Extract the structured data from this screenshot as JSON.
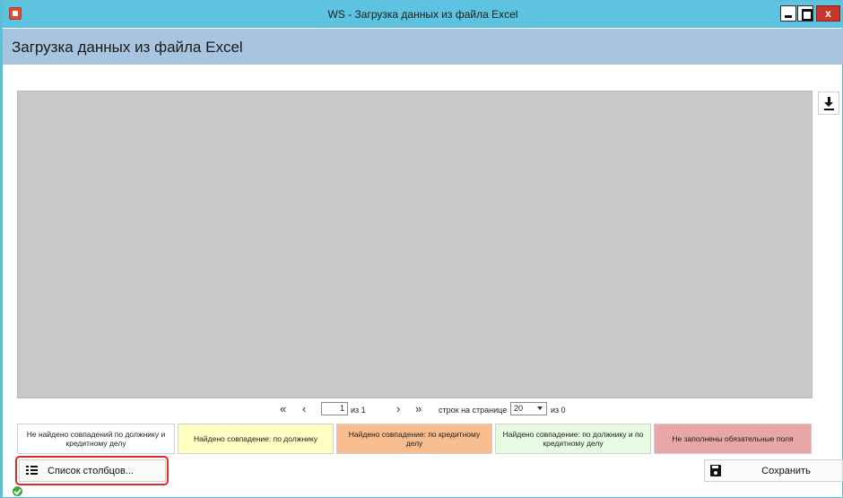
{
  "window": {
    "title": "WS - Загрузка данных из файла Excel",
    "close_label": "x",
    "accent_color": "#5ec3e0",
    "header_color": "#a9c4df"
  },
  "header": {
    "title": "Загрузка данных из файла Excel"
  },
  "grid": {
    "background": "#c8c8c8",
    "rows": []
  },
  "toolbar": {
    "download_icon": "download-icon"
  },
  "pager": {
    "first": "«",
    "prev": "‹",
    "page_value": "1",
    "of_pages": "из 1",
    "next": "›",
    "last": "»",
    "rows_per_page_label": "строк на странице",
    "rows_per_page_value": "20",
    "of_total": "из 0"
  },
  "legend": {
    "items": [
      {
        "label": "Не найдено совпадений по должнику и кредитному делу",
        "color": "#ffffff"
      },
      {
        "label": "Найдено совпадение: по должнику",
        "color": "#ffffc4"
      },
      {
        "label": "Найдено совпадение: по кредитному делу",
        "color": "#f7bd8f"
      },
      {
        "label": "Найдено совпадение: по должнику и по кредитному делу",
        "color": "#e7fbe3"
      },
      {
        "label": "Не заполнены обязательные поля",
        "color": "#e8a6a6"
      }
    ]
  },
  "footer": {
    "columns_button": "Список столбцов...",
    "save_button": "Сохранить",
    "status_icon": "check-circle-icon"
  }
}
